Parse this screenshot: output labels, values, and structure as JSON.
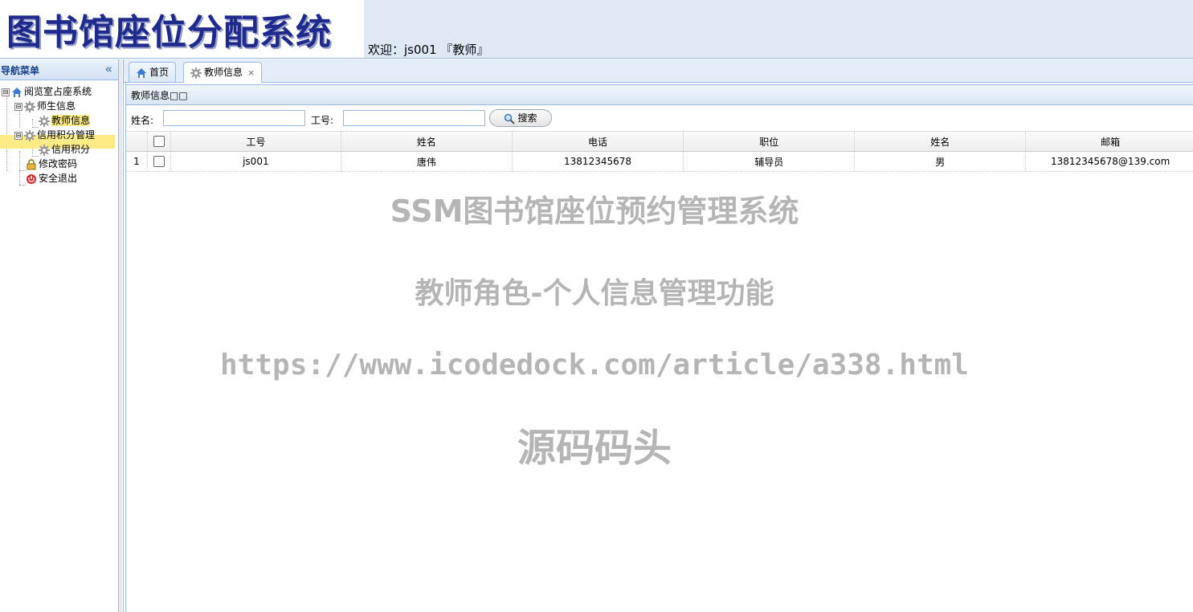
{
  "header": {
    "logo_text": "图书馆座位分配系统",
    "welcome": "欢迎：js001 『教师』"
  },
  "nav": {
    "title": "导航菜单",
    "collapse_glyph": "«",
    "tree": [
      {
        "label": "阅览室占座系统",
        "icon": "home-icon",
        "expander": "⊟"
      },
      {
        "label": "师生信息",
        "icon": "gear-icon",
        "expander": "⊟"
      },
      {
        "label": "教师信息",
        "icon": "gear-icon",
        "selected": true
      },
      {
        "label": "信用积分管理",
        "icon": "gear-icon",
        "expander": "⊟"
      },
      {
        "label": "信用积分",
        "icon": "gear-icon"
      },
      {
        "label": "修改密码",
        "icon": "lock-icon"
      },
      {
        "label": "安全退出",
        "icon": "exit-icon"
      }
    ]
  },
  "tabs": [
    {
      "label": "首页",
      "icon": "home-icon"
    },
    {
      "label": "教师信息",
      "icon": "gear-icon",
      "active": true,
      "close": "×"
    }
  ],
  "grid": {
    "title": "教师信息□□",
    "search": {
      "name_label": "姓名:",
      "name_value": "",
      "id_label": "工号:",
      "id_value": "",
      "button_label": "搜索"
    },
    "columns": [
      "工号",
      "姓名",
      "电话",
      "职位",
      "姓名",
      "邮箱"
    ],
    "rows": [
      {
        "rownum": "1",
        "cells": [
          "js001",
          "唐伟",
          "13812345678",
          "辅导员",
          "男",
          "13812345678@139.com"
        ]
      }
    ]
  },
  "watermark": {
    "line1": "SSM图书馆座位预约管理系统",
    "line2": "教师角色-个人信息管理功能",
    "line3": "https://www.icodedock.com/article/a338.html",
    "line4": "源码码头"
  },
  "colors": {
    "header_bg": "#dfe9f6",
    "border": "#99bbe8",
    "selected_bg": "#fbec88",
    "logo_text": "#1e2a8c",
    "watermark": "#b5b5b5"
  }
}
